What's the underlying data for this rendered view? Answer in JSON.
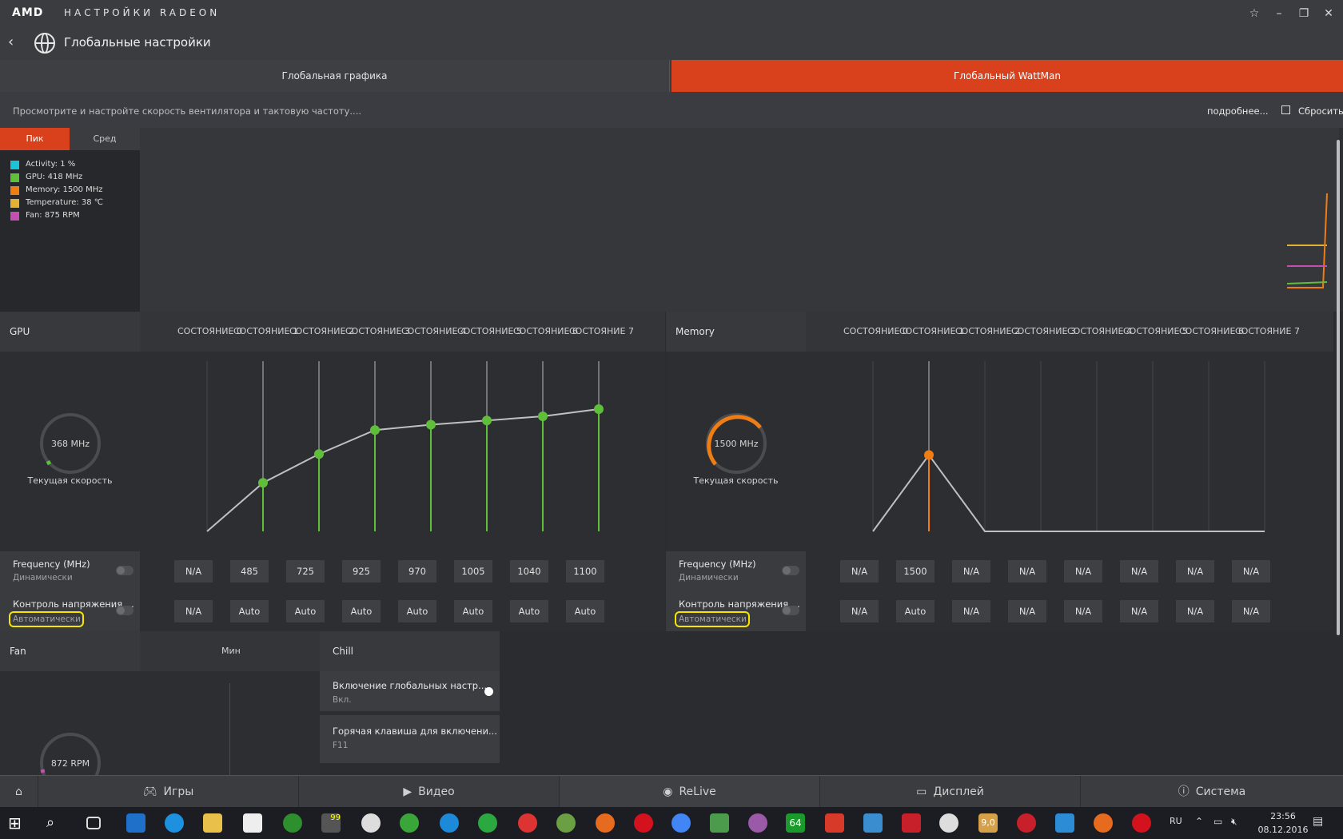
{
  "titlebar": {
    "logo": "AMD",
    "title": "НАСТРОЙКИ RADEON"
  },
  "header": {
    "title": "Глобальные настройки"
  },
  "tabs": [
    {
      "label": "Глобальная графика",
      "active": false
    },
    {
      "label": "Глобальный WattMan",
      "active": true
    }
  ],
  "subheader": {
    "description": "Просмотрите и настройте скорость вентилятора и тактовую частоту....",
    "more": "подробнее...",
    "reset": "Сбросить"
  },
  "monitor": {
    "peak_tab": "Пик",
    "avg_tab": "Сред",
    "legend": [
      {
        "label": "Activity: 1 %",
        "color": "#19c4d6"
      },
      {
        "label": "GPU: 418 MHz",
        "color": "#5fbf3b"
      },
      {
        "label": "Memory: 1500 MHz",
        "color": "#f07d13"
      },
      {
        "label": "Temperature: 38 ℃",
        "color": "#e2b233"
      },
      {
        "label": "Fan: 875 RPM",
        "color": "#c44fb2"
      }
    ]
  },
  "gpu": {
    "title": "GPU",
    "states": [
      "СОСТОЯНИЕ 0",
      "СОСТОЯНИЕ 1",
      "СОСТОЯНИЕ 2",
      "СОСТОЯНИЕ 3",
      "СОСТОЯНИЕ 4",
      "СОСТОЯНИЕ 5",
      "СОСТОЯНИЕ 6",
      "СОСТОЯНИЕ 7"
    ],
    "gauge_value": "368 MHz",
    "gauge_label": "Текущая скорость",
    "frequency_title": "Frequency (MHz)",
    "frequency_sub": "Динамически",
    "voltage_title": "Контроль напряжения ...",
    "voltage_sub": "Автоматически",
    "frequencies": [
      "N/A",
      "485",
      "725",
      "925",
      "970",
      "1005",
      "1040",
      "1100"
    ],
    "voltages": [
      "N/A",
      "Auto",
      "Auto",
      "Auto",
      "Auto",
      "Auto",
      "Auto",
      "Auto"
    ]
  },
  "memory": {
    "title": "Memory",
    "states": [
      "СОСТОЯНИЕ 0",
      "СОСТОЯНИЕ 1",
      "СОСТОЯНИЕ 2",
      "СОСТОЯНИЕ 3",
      "СОСТОЯНИЕ 4",
      "СОСТОЯНИЕ 5",
      "СОСТОЯНИЕ 6",
      "СОСТОЯНИЕ 7"
    ],
    "gauge_value": "1500 MHz",
    "gauge_label": "Текущая скорость",
    "frequency_title": "Frequency (MHz)",
    "frequency_sub": "Динамически",
    "voltage_title": "Контроль напряжения ...",
    "voltage_sub": "Автоматически",
    "frequencies": [
      "N/A",
      "1500",
      "N/A",
      "N/A",
      "N/A",
      "N/A",
      "N/A",
      "N/A"
    ],
    "voltages": [
      "N/A",
      "Auto",
      "N/A",
      "N/A",
      "N/A",
      "N/A",
      "N/A",
      "N/A"
    ]
  },
  "fan": {
    "title": "Fan",
    "min_label": "Мин",
    "gauge_value": "872 RPM"
  },
  "chill": {
    "title": "Chill",
    "items": [
      {
        "title": "Включение глобальных настр...",
        "value": "Вкл."
      },
      {
        "title": "Горячая клавиша для включени...",
        "value": "F11"
      }
    ]
  },
  "bottom_nav": [
    {
      "label": "Игры",
      "icon": "gamepad-icon"
    },
    {
      "label": "Видео",
      "icon": "play-icon"
    },
    {
      "label": "ReLive",
      "icon": "relive-icon"
    },
    {
      "label": "Дисплей",
      "icon": "monitor-icon"
    },
    {
      "label": "Система",
      "icon": "info-icon"
    }
  ],
  "taskbar": {
    "lang": "RU",
    "time": "23:56",
    "date": "08.12.2016",
    "badges": [
      "99",
      "64",
      "9,0"
    ]
  }
}
